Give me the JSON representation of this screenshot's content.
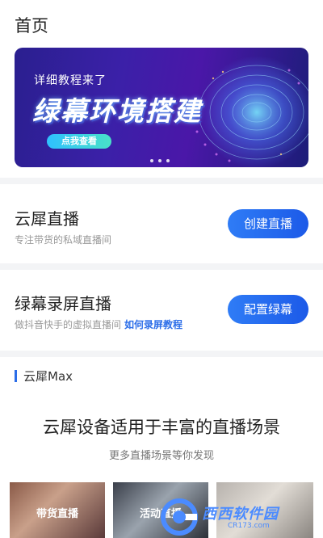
{
  "header": {
    "title": "首页"
  },
  "banner": {
    "subtitle": "详细教程来了",
    "headline": "绿幕环境搭建",
    "cta": "点我查看"
  },
  "cards": [
    {
      "title": "云犀直播",
      "desc": "专注带货的私域直播间",
      "link": "",
      "button": "创建直播"
    },
    {
      "title": "绿幕录屏直播",
      "desc": "做抖音快手的虚拟直播间",
      "link": "如何录屏教程",
      "button": "配置绿幕"
    }
  ],
  "section": {
    "label": "云犀Max",
    "title": "云犀设备适用于丰富的直播场景",
    "subtitle": "更多直播场景等你发现"
  },
  "tiles": [
    {
      "label": "带货直播"
    },
    {
      "label": "活动直播"
    },
    {
      "label": ""
    }
  ],
  "watermark": {
    "text": "西西软件园",
    "url": "CR173.com"
  },
  "colors": {
    "accent": "#2b6de8",
    "banner_bg": "#3b20a8",
    "separator": "#f3f4f6"
  }
}
